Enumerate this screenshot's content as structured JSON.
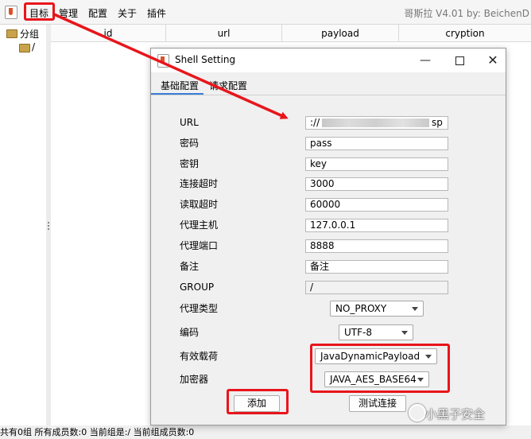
{
  "menubar": {
    "items": [
      "目标",
      "管理",
      "配置",
      "关于",
      "插件"
    ],
    "title_right": "哥斯拉  V4.01 by: BeichenD"
  },
  "tree": {
    "root_label": "分组",
    "child_label": "/"
  },
  "table": {
    "columns": [
      "id",
      "url",
      "payload",
      "cryption"
    ]
  },
  "status": {
    "text": "共有0组 所有成员数:0 当前组是:/ 当前组成员数:0"
  },
  "dialog": {
    "title": "Shell Setting",
    "tabs": [
      "基础配置",
      "请求配置"
    ],
    "fields": [
      {
        "label": "URL",
        "value": "://",
        "suffix": "sp"
      },
      {
        "label": "密码",
        "value": "pass"
      },
      {
        "label": "密钥",
        "value": "key"
      },
      {
        "label": "连接超时",
        "value": "3000"
      },
      {
        "label": "读取超时",
        "value": "60000"
      },
      {
        "label": "代理主机",
        "value": "127.0.0.1"
      },
      {
        "label": "代理端口",
        "value": "8888"
      },
      {
        "label": "备注",
        "value": "备注"
      },
      {
        "label": "GROUP",
        "value": "/"
      }
    ],
    "proxy_type": {
      "label": "代理类型",
      "value": "NO_PROXY"
    },
    "encoding": {
      "label": "编码",
      "value": "UTF-8"
    },
    "payload": {
      "label": "有效载荷",
      "value": "JavaDynamicPayload"
    },
    "cryption": {
      "label": "加密器",
      "value": "JAVA_AES_BASE64"
    },
    "add_button": "添加",
    "test_button": "测试连接"
  },
  "watermark": "小黑子安全",
  "colors": {
    "highlight": "#e8151b",
    "tab_accent": "#3b7dd8"
  }
}
